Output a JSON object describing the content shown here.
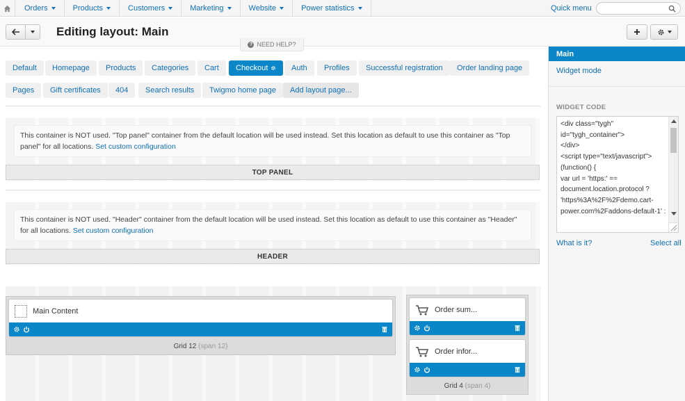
{
  "topnav": {
    "home_icon": "home-icon",
    "menu": [
      {
        "label": "Orders"
      },
      {
        "label": "Products"
      },
      {
        "label": "Customers"
      },
      {
        "label": "Marketing"
      },
      {
        "label": "Website"
      },
      {
        "label": "Power statistics"
      }
    ],
    "quick_menu": "Quick menu",
    "search_value": ""
  },
  "header": {
    "title": "Editing layout: Main",
    "need_help": "NEED HELP?"
  },
  "tabs": [
    {
      "label": "Default"
    },
    {
      "label": "Homepage"
    },
    {
      "label": "Products"
    },
    {
      "label": "Categories"
    },
    {
      "label": "Cart"
    },
    {
      "label": "Checkout",
      "active": true
    },
    {
      "label": "Auth"
    },
    {
      "label": "Profiles"
    },
    {
      "label": "Successful registration"
    },
    {
      "label": "Order landing page"
    },
    {
      "label": "Pages"
    },
    {
      "label": "Gift certificates"
    },
    {
      "label": "404"
    },
    {
      "label": "Search results"
    },
    {
      "label": "Twigmo home page"
    },
    {
      "label": "Add layout page..."
    }
  ],
  "containers": {
    "top_panel": {
      "notice": "This container is NOT used. \"Top panel\" container from the default location will be used instead. Set this location as default to use this container as \"Top panel\" for all locations.",
      "link": "Set custom configuration",
      "label": "TOP PANEL"
    },
    "header": {
      "notice": "This container is NOT used. \"Header\" container from the default location will be used instead. Set this location as default to use this container as \"Header\" for all locations.",
      "link": "Set custom configuration",
      "label": "HEADER"
    }
  },
  "grids": {
    "main": {
      "block": "Main Content",
      "label": "Grid 12",
      "span": "(span 12)"
    },
    "side": {
      "blocks": [
        "Order sum...",
        "Order infor..."
      ],
      "label": "Grid 4",
      "span": "(span 4)"
    }
  },
  "sidebar": {
    "active": "Main",
    "widget_mode": "Widget mode",
    "widget_code_title": "WIDGET CODE",
    "widget_code": "<div class=\"tygh\" id=\"tygh_container\">\n</div>\n<script type=\"text/javascript\">\n(function() {\nvar url = 'https:' == document.location.protocol ? 'https%3A%2F%2Fdemo.cart-power.com%2Faddons-default-1' :",
    "what_is_it": "What is it?",
    "select_all": "Select all"
  },
  "colors": {
    "accent": "#0b86c9",
    "link": "#0f6fb6"
  }
}
